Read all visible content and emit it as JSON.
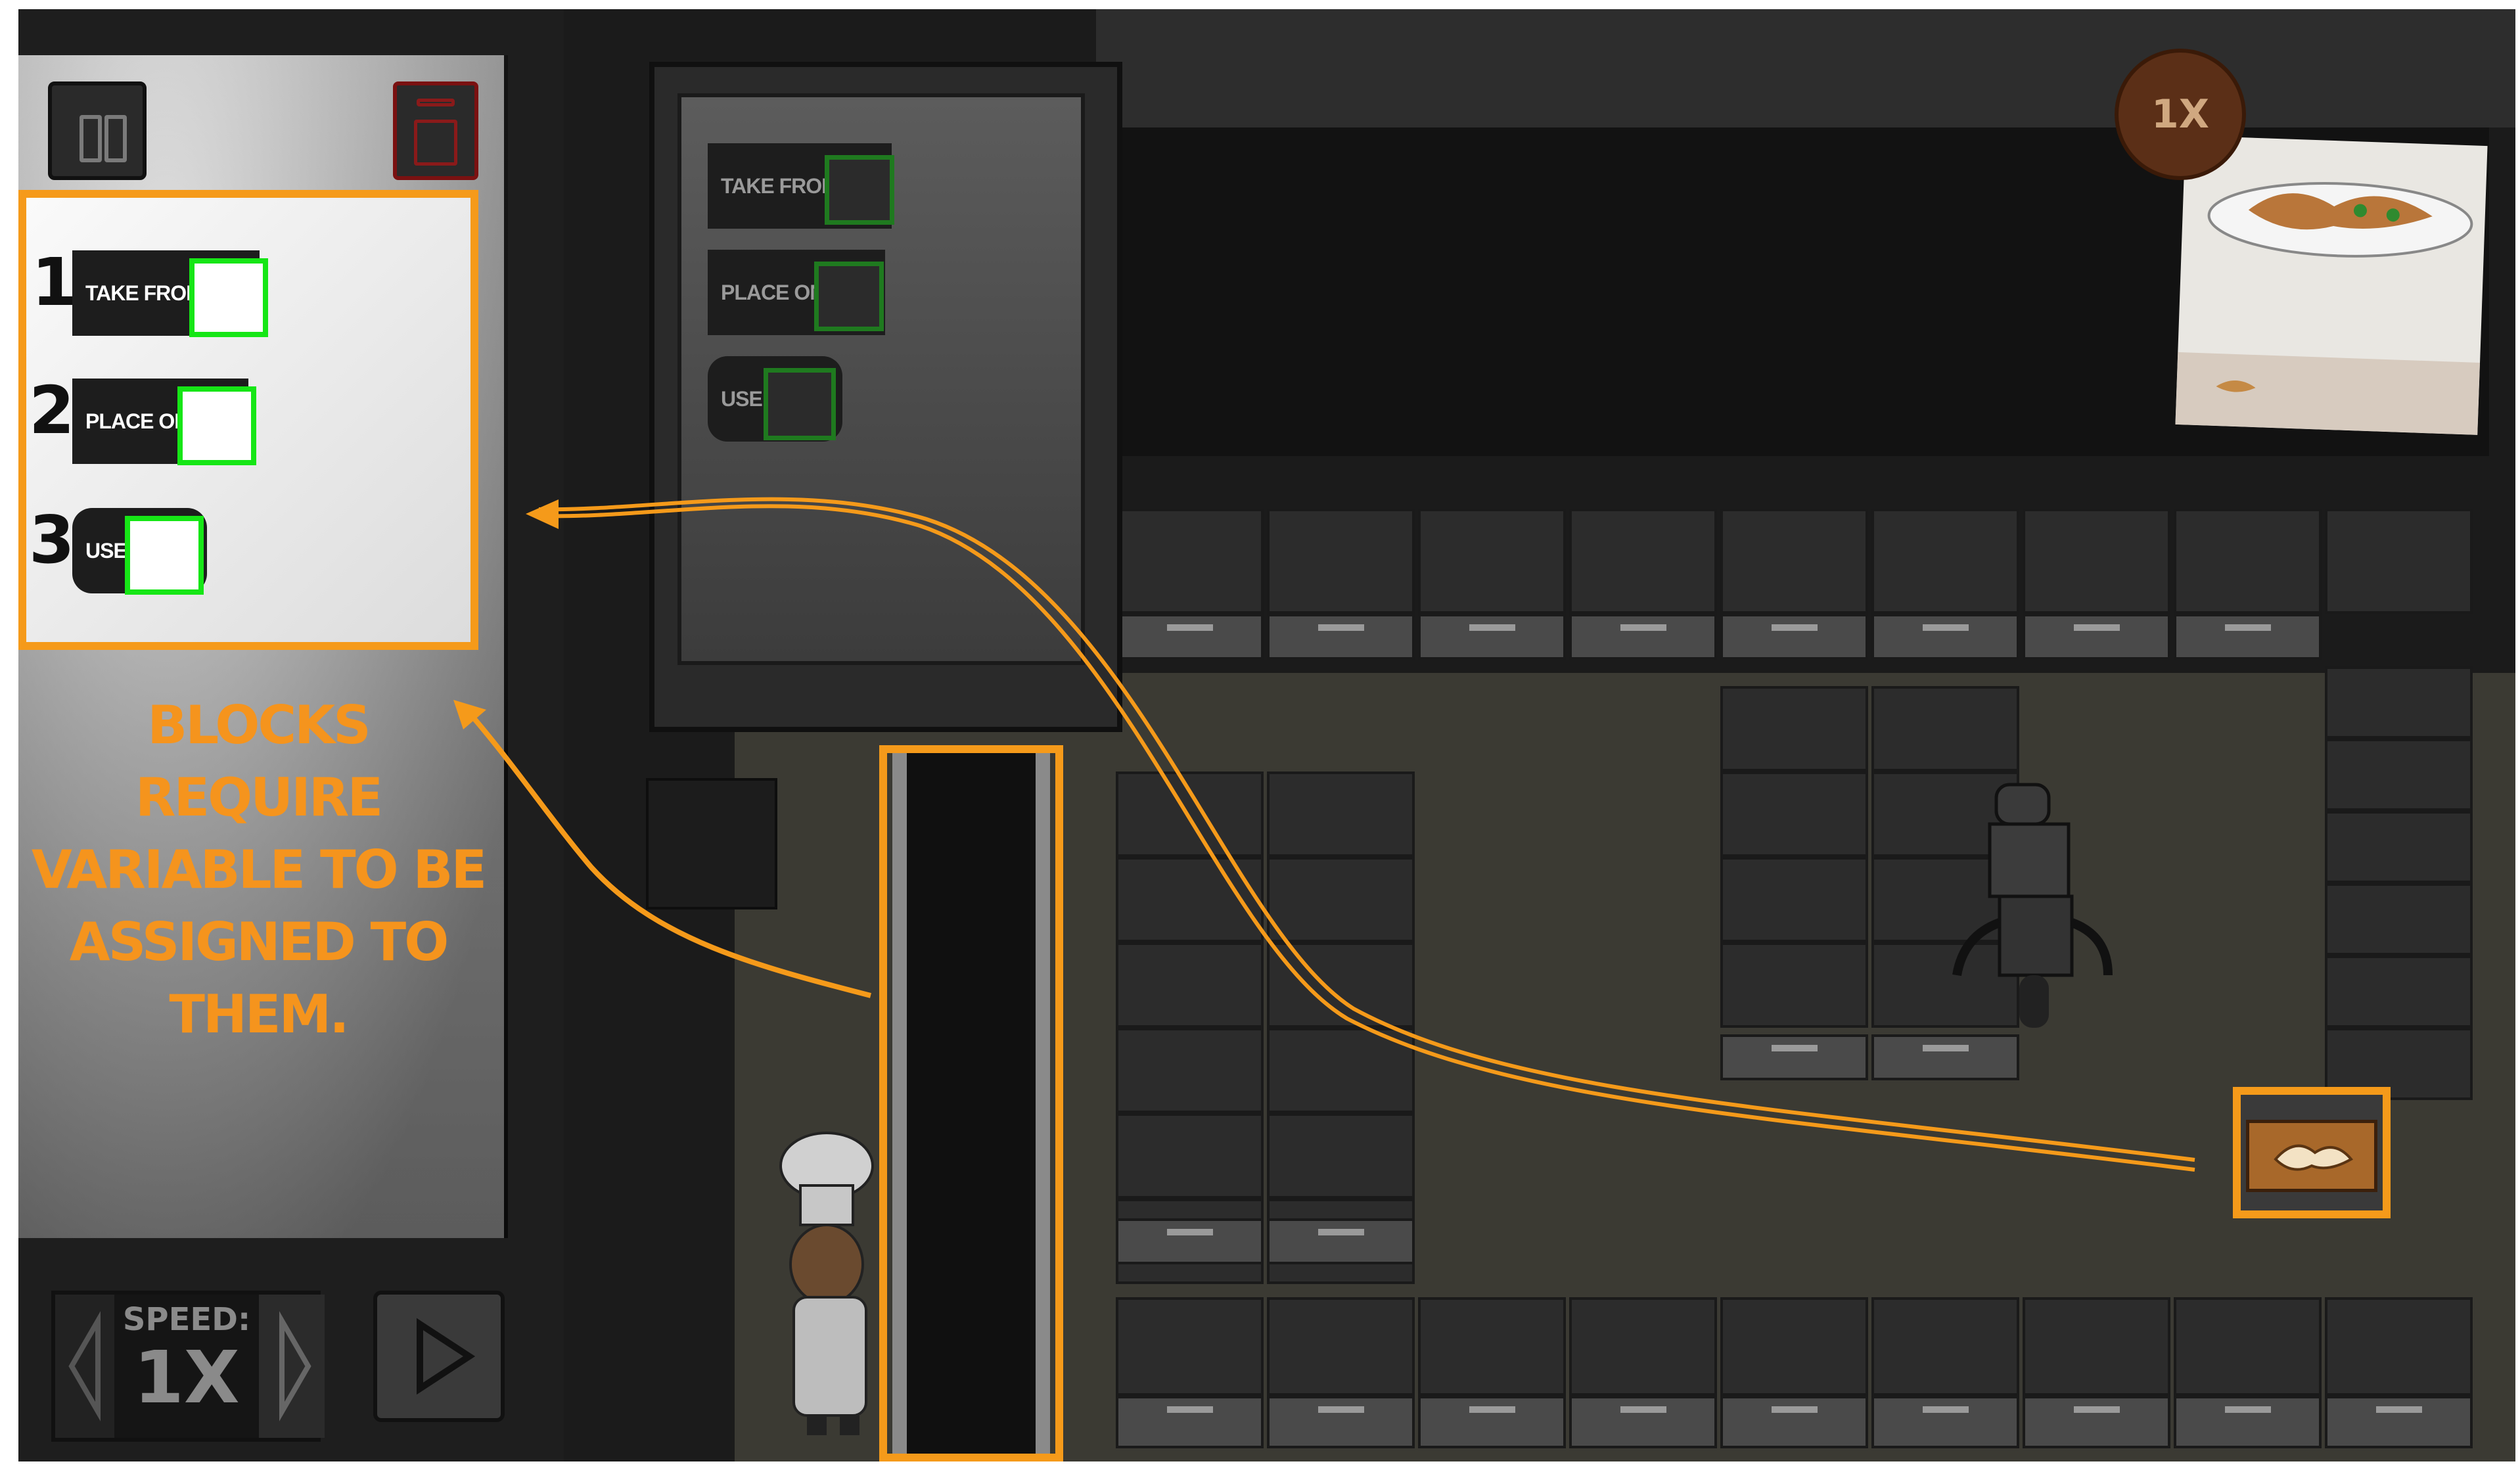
{
  "code_panel": {
    "blocks": [
      {
        "number": "1",
        "label": "TAKE FROM"
      },
      {
        "number": "2",
        "label": "PLACE ON"
      },
      {
        "number": "3",
        "label": "USE"
      }
    ]
  },
  "palette": {
    "blocks": [
      {
        "label": "TAKE FROM"
      },
      {
        "label": "PLACE ON"
      },
      {
        "label": "USE"
      }
    ]
  },
  "annotation": {
    "caption_line1": "BLOCKS REQUIRE",
    "caption_line2": "VARIABLE TO BE",
    "caption_line3": "ASSIGNED TO THEM.",
    "color": "#f59a1a"
  },
  "controls": {
    "speed_label": "SPEED:",
    "speed_value": "1X"
  },
  "order": {
    "multiplier": "1X"
  },
  "icons": [
    "pause-icon",
    "trash-icon",
    "play-icon",
    "arrow-left-icon",
    "arrow-right-icon"
  ]
}
